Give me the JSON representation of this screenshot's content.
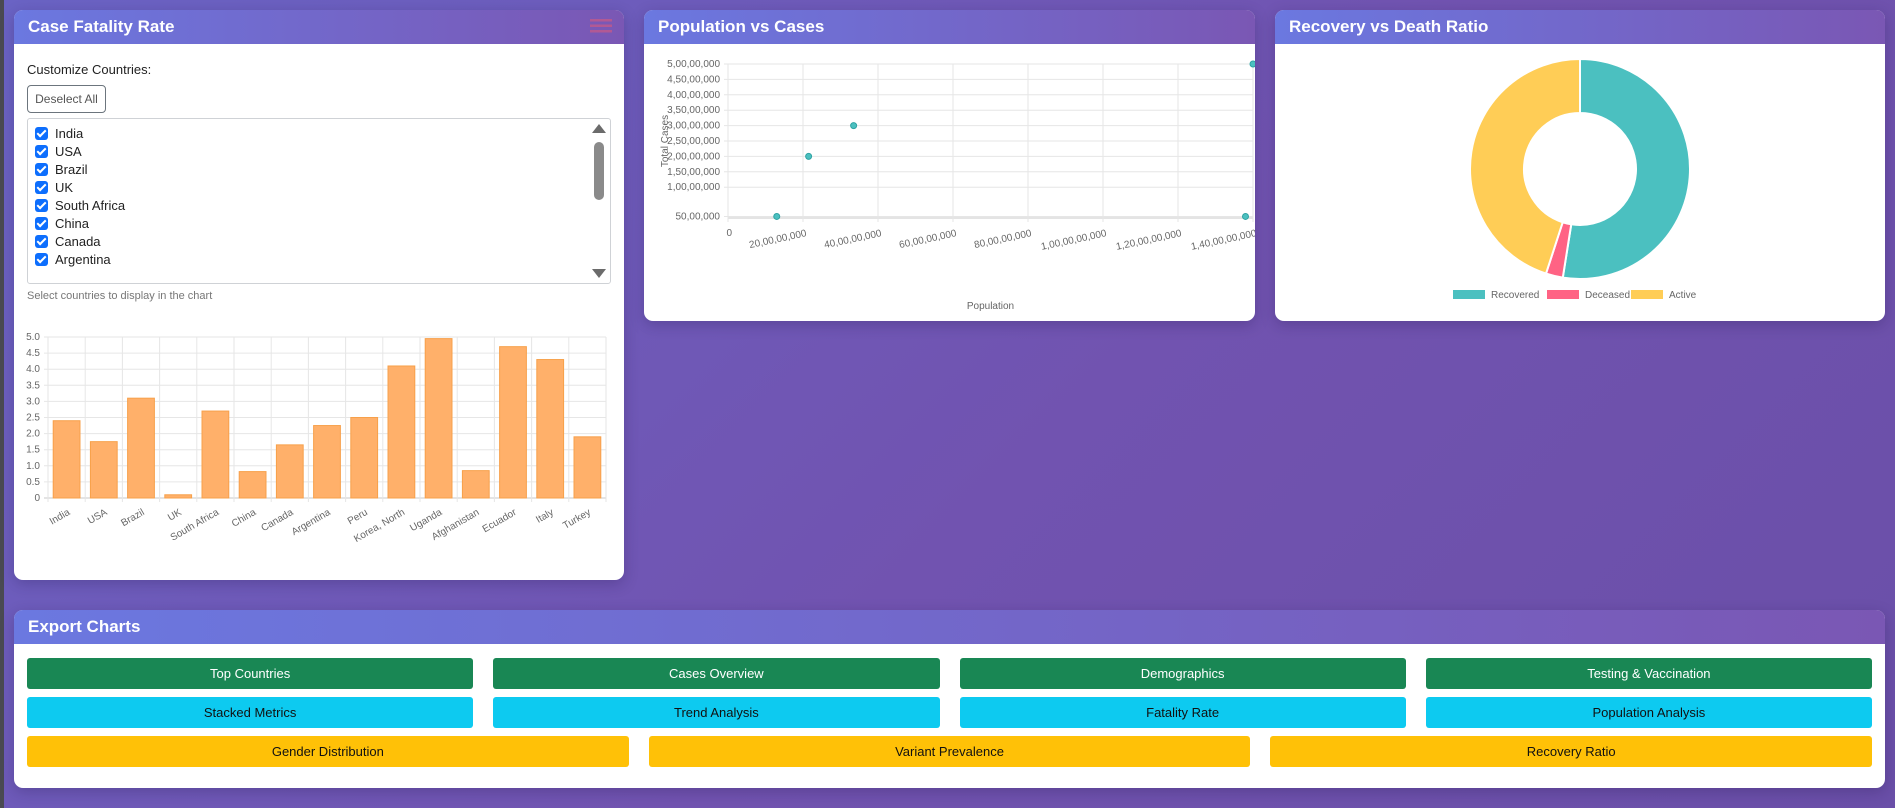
{
  "cfr_card": {
    "title": "Case Fatality Rate",
    "customize_label": "Customize Countries:",
    "deselect_label": "Deselect All",
    "countries": [
      "India",
      "USA",
      "Brazil",
      "UK",
      "South Africa",
      "China",
      "Canada",
      "Argentina"
    ],
    "hint": "Select countries to display in the chart"
  },
  "pop_card": {
    "title": "Population vs Cases"
  },
  "rec_card": {
    "title": "Recovery vs Death Ratio"
  },
  "export": {
    "title": "Export Charts",
    "row1": [
      "Top Countries",
      "Cases Overview",
      "Demographics",
      "Testing & Vaccination"
    ],
    "row2": [
      "Stacked Metrics",
      "Trend Analysis",
      "Fatality Rate",
      "Population Analysis"
    ],
    "row3": [
      "Gender Distribution",
      "Variant Prevalence",
      "Recovery Ratio"
    ]
  },
  "colors": {
    "bar_fill": "#ffb06a",
    "bar_stroke": "#f7a04a",
    "scatter": "#4bc0c0",
    "recovered": "#4bc0c0",
    "deceased": "#ff6384",
    "active": "#ffcd56",
    "btn_green": "#198754",
    "btn_cyan": "#0dcaf0",
    "btn_yellow": "#ffc107"
  },
  "chart_data": [
    {
      "type": "bar",
      "categories": [
        "India",
        "USA",
        "Brazil",
        "UK",
        "South Africa",
        "China",
        "Canada",
        "Argentina",
        "Peru",
        "Korea, North",
        "Uganda",
        "Afghanistan",
        "Ecuador",
        "Italy",
        "Turkey"
      ],
      "values": [
        2.4,
        1.75,
        3.1,
        0.1,
        2.7,
        0.82,
        1.65,
        2.25,
        2.5,
        4.1,
        4.95,
        0.85,
        4.7,
        4.3,
        1.9
      ],
      "ylim": [
        0,
        5
      ],
      "yticks": [
        "0",
        "0.5",
        "1.0",
        "1.5",
        "2.0",
        "2.5",
        "3.0",
        "3.5",
        "4.0",
        "4.5",
        "5.0"
      ],
      "grid": true
    },
    {
      "type": "scatter",
      "xlabel": "Population",
      "ylabel": "Total Cases",
      "xlim": [
        0,
        1400000000
      ],
      "ylim": [
        0,
        500000000
      ],
      "xticks": [
        "0",
        "20,00,00,000",
        "40,00,00,000",
        "60,00,00,000",
        "80,00,00,000",
        "1,00,00,00,000",
        "1,20,00,00,000",
        "1,40,00,00,000"
      ],
      "yticks": [
        "50,00,000",
        "1,00,00,000",
        "1,50,00,000",
        "2,00,00,000",
        "2,50,00,000",
        "3,00,00,000",
        "3,50,00,000",
        "4,00,00,000",
        "4,50,00,000",
        "5,00,00,000"
      ],
      "points": [
        {
          "x": 130000000,
          "y": 5000000
        },
        {
          "x": 215000000,
          "y": 200000000
        },
        {
          "x": 335000000,
          "y": 300000000
        },
        {
          "x": 1380000000,
          "y": 5000000
        },
        {
          "x": 1400000000,
          "y": 500000000
        }
      ],
      "grid": true
    },
    {
      "type": "pie",
      "labels": [
        "Recovered",
        "Deceased",
        "Active"
      ],
      "values": [
        52.5,
        2.5,
        45
      ],
      "legend": "bottom"
    }
  ]
}
